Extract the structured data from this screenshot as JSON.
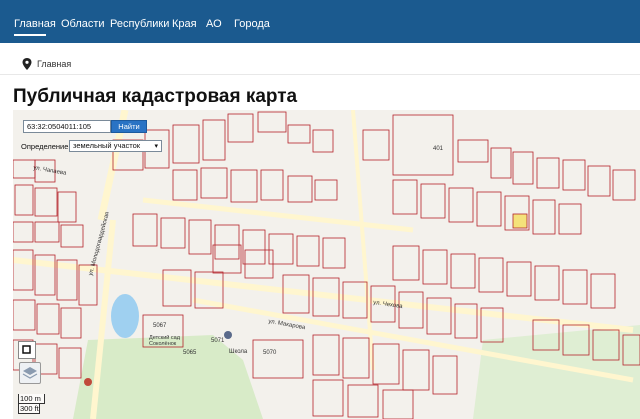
{
  "topnav": {
    "items": [
      "Главная",
      "Области",
      "Республики",
      "Края",
      "АО",
      "Города"
    ],
    "active_index": 0,
    "background": "#1b5a8f"
  },
  "breadcrumb": {
    "icon": "pin-icon",
    "text": "Главная"
  },
  "page": {
    "title": "Публичная кадастровая карта"
  },
  "map": {
    "search": {
      "value": "63:32:0504011:105",
      "button_label": "Найти"
    },
    "definition": {
      "label": "Определение:",
      "selected": "земельный участок"
    },
    "scale": {
      "upper": "100 m",
      "lower": "300 ft"
    },
    "labels": {
      "school_top": "5067",
      "school_lower": "5071",
      "school_name": "Школа",
      "garden_name": "Детский сад Соколёнок",
      "parcel_5070": "5070",
      "parcel_5065": "5065",
      "parcel_401": "401",
      "street_makarova": "ул. Макарова",
      "street_chekhova": "ул. Чехова",
      "street_molodogvardeyskaya": "ул. Молодогвардейская",
      "street_chapaeva": "ул. Чапаева"
    },
    "colors": {
      "parcel_stroke": "#b3242b",
      "green_area": "#d8ebc8",
      "pond": "#9fd0f0",
      "road": "#fff6cf"
    }
  }
}
